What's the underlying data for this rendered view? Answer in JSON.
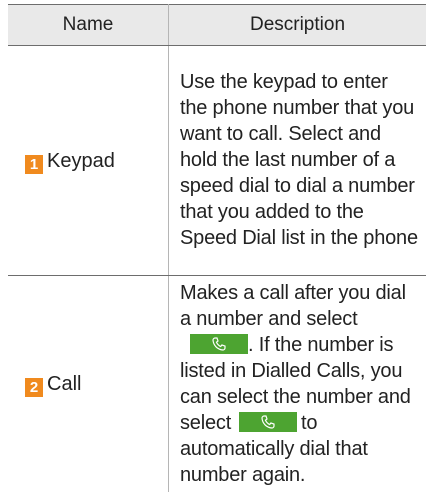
{
  "table": {
    "headers": {
      "name": "Name",
      "description": "Description"
    },
    "rows": [
      {
        "number": "1",
        "name": "Keypad",
        "description": "Use the keypad to enter the phone number that you want to call. Select and hold the last number of a speed dial to dial a number that you added to the Speed Dial list in the phone"
      },
      {
        "number": "2",
        "name": "Call",
        "description_part1": "Makes a call after you dial a number and select",
        "description_part2": ". If the number is listed in Dialled Calls, you can select the number and select",
        "description_part3": "to automatically dial that number again."
      }
    ]
  },
  "icons": {
    "call_button": "phone-handset-icon"
  },
  "colors": {
    "badge": "#f08a1e",
    "call_button": "#4da431",
    "header_bg": "#e9e9e9"
  }
}
